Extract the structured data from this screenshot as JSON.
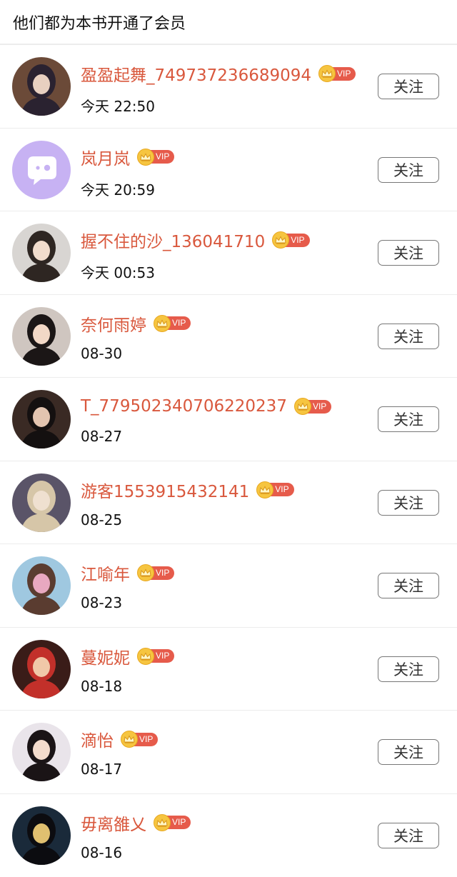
{
  "header": {
    "title": "他们都为本书开通了会员"
  },
  "vip_label": "VIP",
  "follow_label": "关注",
  "members": [
    {
      "name": "盈盈起舞_749737236689094",
      "time": "今天 22:50",
      "avatar": "avatar-1",
      "avatar_colors": [
        "#6b4a38",
        "#2a2230",
        "#e8d0c0"
      ]
    },
    {
      "name": "岚月岚",
      "time": "今天 20:59",
      "avatar": "default-chat-avatar",
      "avatar_colors": [
        "#c7b2f3",
        "#ffffff",
        "#c7b2f3"
      ]
    },
    {
      "name": "握不住的沙_136041710",
      "time": "今天 00:53",
      "avatar": "avatar-3",
      "avatar_colors": [
        "#d8d5d2",
        "#2e2622",
        "#f1dccc"
      ]
    },
    {
      "name": "奈何雨婷",
      "time": "08-30",
      "avatar": "avatar-4",
      "avatar_colors": [
        "#cfc6c0",
        "#1b1616",
        "#f2d8c6"
      ]
    },
    {
      "name": "T_77950234070622023​7",
      "time": "08-27",
      "avatar": "avatar-5",
      "avatar_colors": [
        "#3a2a24",
        "#141010",
        "#e2c4b0"
      ]
    },
    {
      "name": "游客1553915432141",
      "time": "08-25",
      "avatar": "avatar-6",
      "avatar_colors": [
        "#5a5468",
        "#d6c6a8",
        "#efe0d0"
      ]
    },
    {
      "name": "江喻年",
      "time": "08-23",
      "avatar": "avatar-7",
      "avatar_colors": [
        "#9fc8e0",
        "#5a3c30",
        "#e8a8c0"
      ]
    },
    {
      "name": "蔓妮妮",
      "time": "08-18",
      "avatar": "avatar-8",
      "avatar_colors": [
        "#3a1c18",
        "#c2302a",
        "#f0c8a8"
      ]
    },
    {
      "name": "滴怡",
      "time": "08-17",
      "avatar": "avatar-9",
      "avatar_colors": [
        "#e9e4ea",
        "#1a1416",
        "#f4dccd"
      ]
    },
    {
      "name": "毋离雒乂",
      "time": "08-16",
      "avatar": "avatar-10",
      "avatar_colors": [
        "#1a2a3a",
        "#0c0c10",
        "#e0c070"
      ]
    }
  ]
}
